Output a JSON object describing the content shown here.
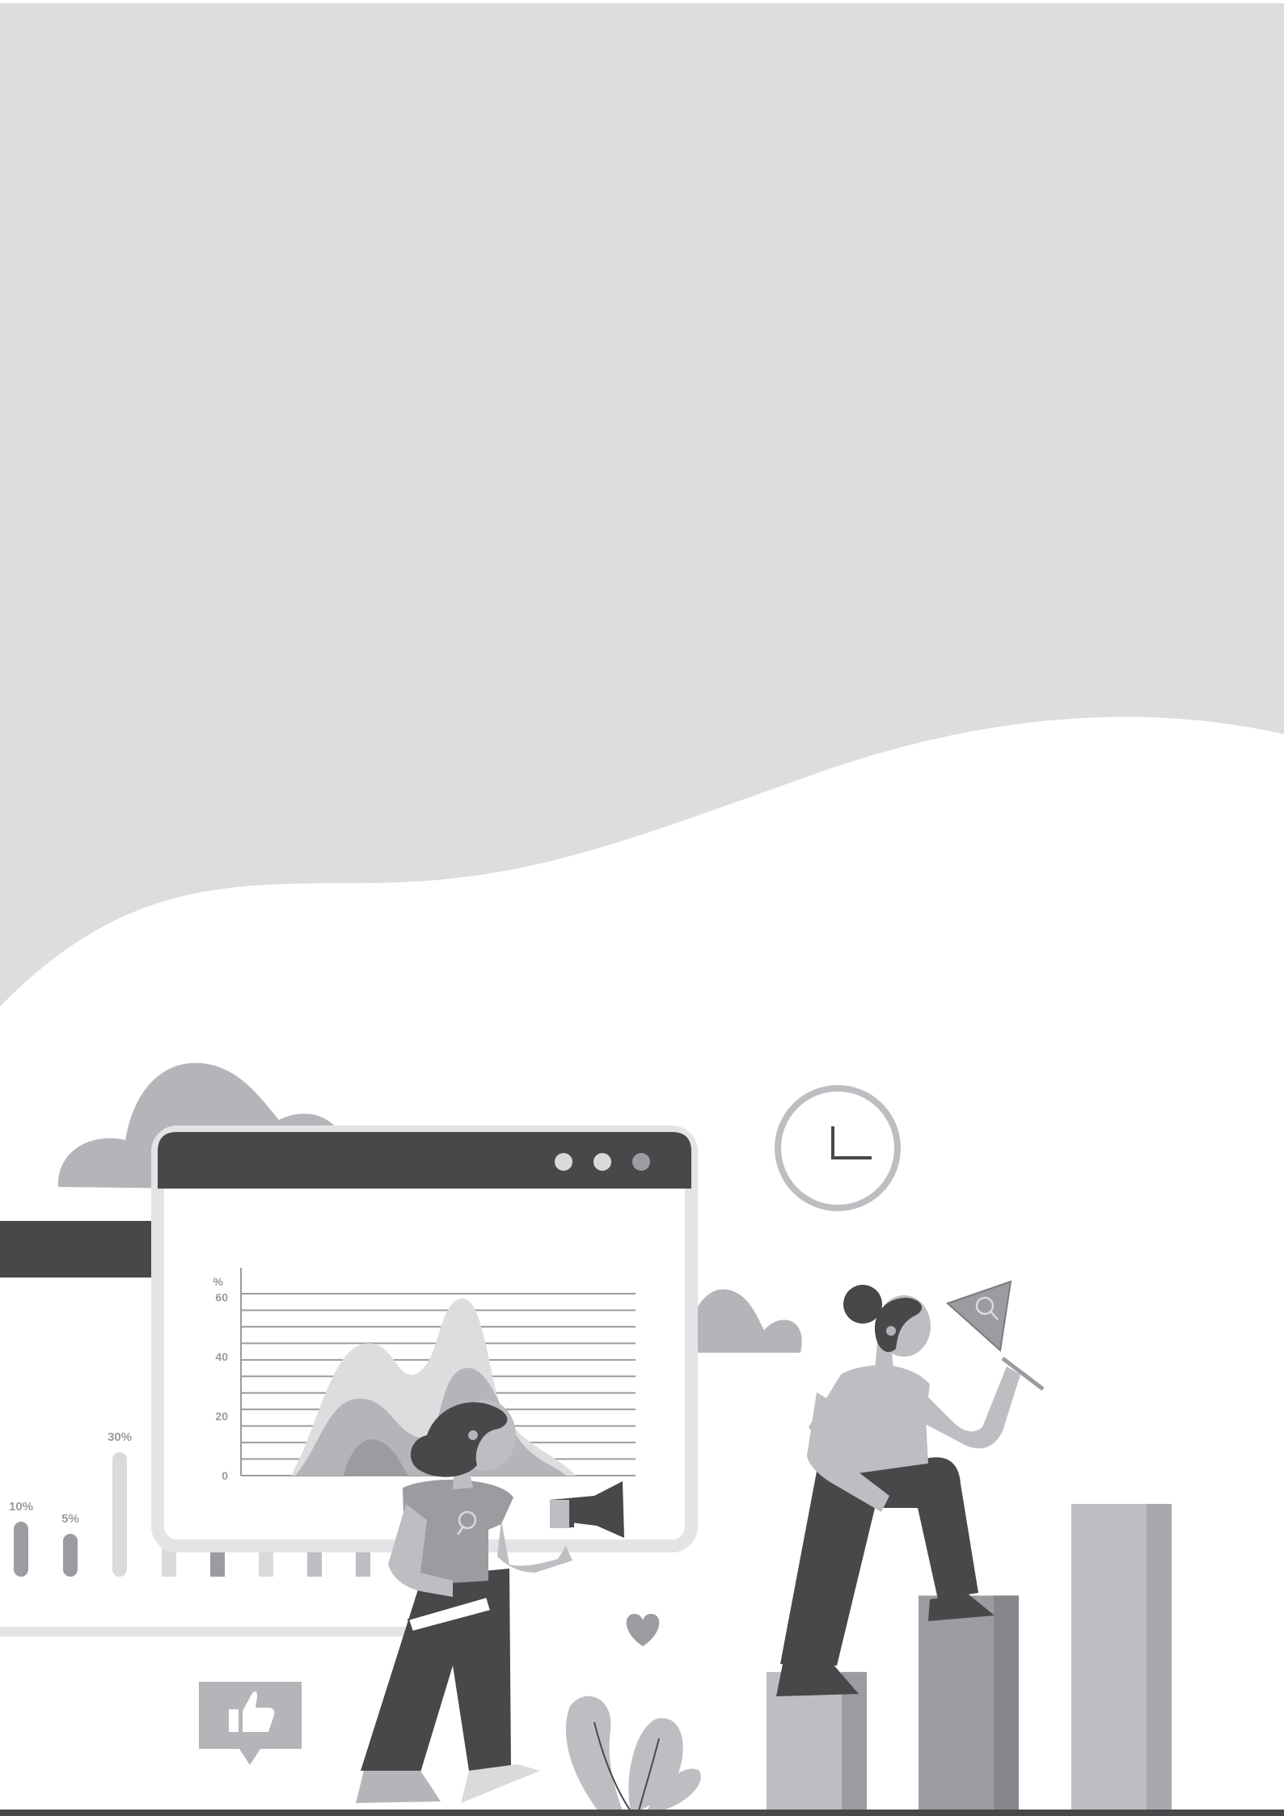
{
  "colors": {
    "background": "#ffffff",
    "band": "#dcdddf",
    "dark": "#48484a",
    "mid": "#9b9c9f",
    "light": "#bdbec1",
    "pale": "#d9dadc",
    "cloud": "#b4b5b8",
    "window_border": "#e3e4e5"
  },
  "small_bar_chart": {
    "labels": [
      "10%",
      "5%",
      "30%"
    ],
    "values": [
      10,
      5,
      30
    ]
  },
  "window_chart": {
    "y_unit_label": "%",
    "y_ticks": [
      "0",
      "20",
      "40",
      "60"
    ],
    "ylim": [
      0,
      70
    ],
    "window_dots": 3
  },
  "podium": {
    "relative_heights": [
      0.45,
      0.7,
      1.0
    ]
  },
  "icons": [
    "clock-icon",
    "thumbs-up-icon",
    "heart-icon",
    "megaphone-icon",
    "female-symbol-icon",
    "flag-icon"
  ]
}
